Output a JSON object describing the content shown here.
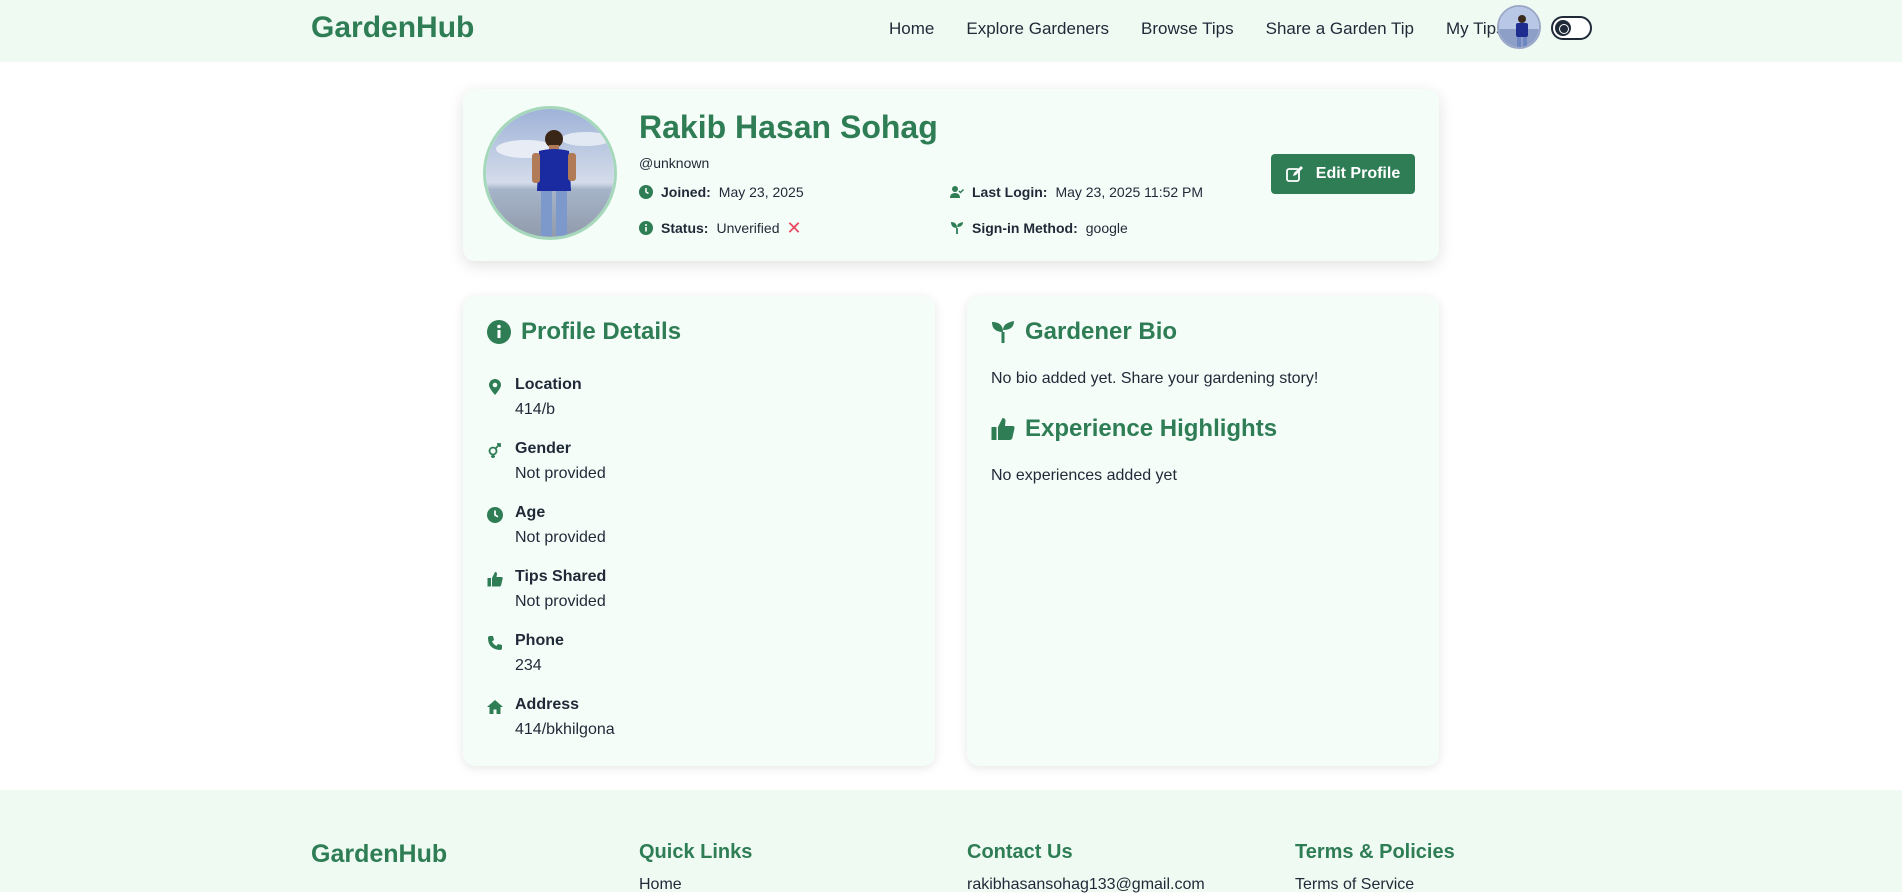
{
  "nav": {
    "brand": "GardenHub",
    "links": [
      "Home",
      "Explore Gardeners",
      "Browse Tips",
      "Share a Garden Tip",
      "My Tips"
    ]
  },
  "profile": {
    "name": "Rakib Hasan Sohag",
    "handle": "@unknown",
    "joined_label": "Joined:",
    "joined_value": "May 23, 2025",
    "status_label": "Status:",
    "status_value": "Unverified",
    "last_login_label": "Last Login:",
    "last_login_value": "May 23, 2025 11:52 PM",
    "signin_label": "Sign-in Method:",
    "signin_value": "google",
    "edit_button": "Edit Profile"
  },
  "details": {
    "title": "Profile Details",
    "items": [
      {
        "label": "Location",
        "value": "414/b",
        "icon": "map-pin-icon"
      },
      {
        "label": "Gender",
        "value": "Not provided",
        "icon": "gender-icon"
      },
      {
        "label": "Age",
        "value": "Not provided",
        "icon": "clock-icon"
      },
      {
        "label": "Tips Shared",
        "value": "Not provided",
        "icon": "thumbs-up-icon"
      },
      {
        "label": "Phone",
        "value": "234",
        "icon": "phone-icon"
      },
      {
        "label": "Address",
        "value": "414/bkhilgona",
        "icon": "home-icon"
      }
    ]
  },
  "bio": {
    "title": "Gardener Bio",
    "text": "No bio added yet. Share your gardening story!",
    "experience_title": "Experience Highlights",
    "experience_text": "No experiences added yet"
  },
  "footer": {
    "brand": "GardenHub",
    "quick_links_title": "Quick Links",
    "quick_links_first": "Home",
    "contact_title": "Contact Us",
    "contact_email": "rakibhasansohag133@gmail.com",
    "terms_title": "Terms & Policies",
    "terms_first": "Terms of Service"
  },
  "colors": {
    "brand": "#2e7d55",
    "nav_bg": "#effaf3",
    "card_bg": "#f5fdf8",
    "error": "#e8455e"
  }
}
